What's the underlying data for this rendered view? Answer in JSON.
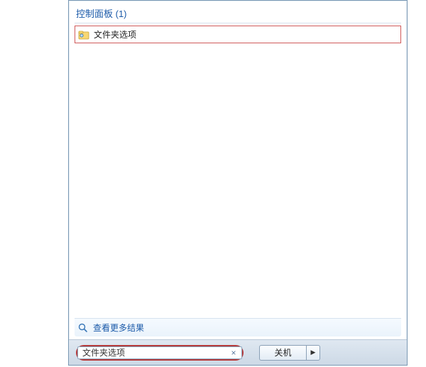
{
  "category": {
    "label": "控制面板 (1)"
  },
  "results": {
    "item0": {
      "label": "文件夹选项"
    }
  },
  "more": {
    "label": "查看更多结果"
  },
  "search": {
    "value": "文件夹选项"
  },
  "shutdown": {
    "label": "关机"
  }
}
